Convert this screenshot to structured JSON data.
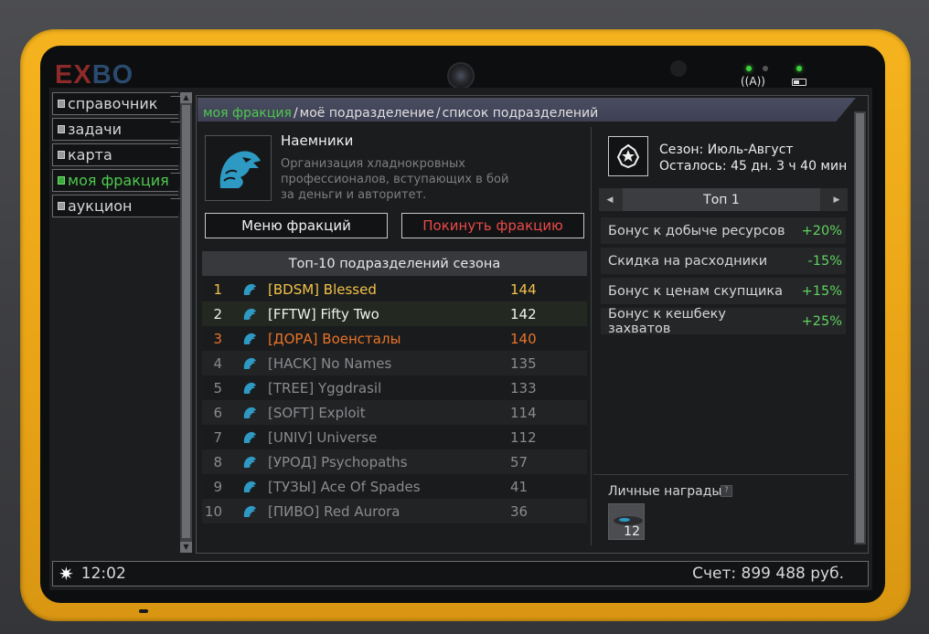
{
  "brand": {
    "logo_left": "EX",
    "logo_right": "BO"
  },
  "nav": {
    "items": [
      {
        "label": "справочник",
        "active": false
      },
      {
        "label": "задачи",
        "active": false
      },
      {
        "label": "карта",
        "active": false
      },
      {
        "label": "моя фракция",
        "active": true
      },
      {
        "label": "аукцион",
        "active": false
      }
    ]
  },
  "breadcrumb": {
    "items": [
      "моя фракция",
      "моё подразделение",
      "список подразделений"
    ],
    "separator": "/"
  },
  "faction": {
    "name": "Наемники",
    "description": "Организация хладнокровных профессионалов, вступающих в бой за деньги и авторитет.",
    "emblem_icon": "eagle-head-icon",
    "emblem_color": "#2e9ac4"
  },
  "buttons": {
    "menu_label": "Меню фракций",
    "leave_label": "Покинуть фракцию"
  },
  "leaderboard": {
    "title": "Топ-10 подразделений сезона",
    "rows": [
      {
        "rank": "1",
        "name": "[BDSM] Blessed",
        "score": "144",
        "tone": "gold"
      },
      {
        "rank": "2",
        "name": "[FFTW] Fifty Two",
        "score": "142",
        "tone": "white"
      },
      {
        "rank": "3",
        "name": "[ДОРА] Военсталы",
        "score": "140",
        "tone": "orange"
      },
      {
        "rank": "4",
        "name": "[HACK] No Names",
        "score": "135",
        "tone": "grey"
      },
      {
        "rank": "5",
        "name": "[TREE] Yggdrasil",
        "score": "133",
        "tone": "grey"
      },
      {
        "rank": "6",
        "name": "[SOFT] Exploit",
        "score": "114",
        "tone": "grey"
      },
      {
        "rank": "7",
        "name": "[UNIV] Universe",
        "score": "112",
        "tone": "grey"
      },
      {
        "rank": "8",
        "name": "[УРОД] Psychopaths",
        "score": "57",
        "tone": "grey"
      },
      {
        "rank": "9",
        "name": "[ТУЗЫ] Ace Of Spades",
        "score": "41",
        "tone": "grey"
      },
      {
        "rank": "10",
        "name": "[ПИВО] Red Aurora",
        "score": "36",
        "tone": "grey"
      }
    ]
  },
  "season": {
    "line1": "Сезон: Июль-Август",
    "line2": "Осталось: 45 дн. 3 ч 40 мин",
    "icon": "star-icon"
  },
  "tier": {
    "label": "Топ 1"
  },
  "bonuses": [
    {
      "label": "Бонус к добыче ресурсов",
      "value": "+20%"
    },
    {
      "label": "Скидка на расходники",
      "value": "-15%"
    },
    {
      "label": "Бонус к ценам скупщика",
      "value": "+15%"
    },
    {
      "label": "Бонус к кешбеку захватов",
      "value": "+25%"
    }
  ],
  "rewards": {
    "title": "Личные награды",
    "help": "?",
    "items": [
      {
        "count": "12"
      }
    ]
  },
  "status_bar": {
    "time": "12:02",
    "balance": "Счет: 899 488 руб."
  },
  "colors": {
    "accent_green": "#4ec94e",
    "danger": "#e84a4a",
    "gold": "#f2c24a",
    "orange": "#e8742a",
    "case_yellow": "#f5b31e"
  }
}
